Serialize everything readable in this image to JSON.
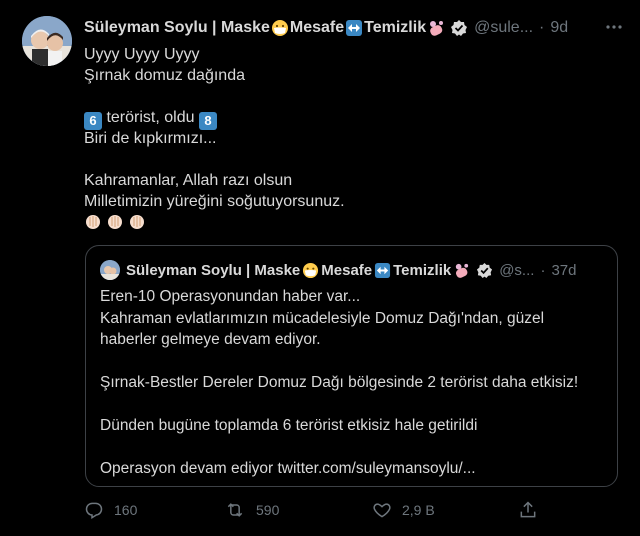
{
  "author": {
    "name": "Süleyman Soylu | Maske",
    "name_part2": "Mesafe",
    "name_part3": "Temizlik",
    "handle": "@sule...",
    "separator": "·",
    "time": "9d"
  },
  "tweet": {
    "lines": [
      "Uyyy Uyyy Uyyy",
      "Şırnak domuz dağında",
      "",
      "terörist, oldu",
      "Biri de kıpkırmızı...",
      "",
      "Kahramanlar, Allah razı olsun",
      "Milletimizin yüreğini soğutuyorsunuz."
    ],
    "keycap_left": "6",
    "keycap_right": "8"
  },
  "quoted": {
    "name": "Süleyman Soylu | Maske",
    "name_part2": "Mesafe",
    "name_part3": "Temizlik",
    "handle": "@s...",
    "separator": "·",
    "time": "37d",
    "lines": [
      "Eren-10 Operasyonundan haber var...",
      "Kahraman evlatlarımızın mücadelesiyle Domuz Dağı'ndan, güzel",
      "haberler gelmeye devam ediyor.",
      "",
      "Şırnak-Bestler Dereler Domuz Dağı bölgesinde 2 terörist daha etkisiz!",
      "",
      "Dünden bugüne toplamda 6 terörist etkisiz hale getirildi",
      "",
      "Operasyon devam ediyor twitter.com/suleymansoylu/..."
    ]
  },
  "actions": {
    "reply_count": "160",
    "retweet_count": "590",
    "like_count": "2,9 B"
  },
  "icons": {
    "more": "more-icon",
    "verified": "verified-badge-icon",
    "mask": "face-with-mask-icon",
    "arrows": "left-right-arrow-icon",
    "soap": "soap-icon",
    "clap": "clapping-hands-icon",
    "reply": "reply-icon",
    "retweet": "retweet-icon",
    "like": "heart-icon",
    "share": "share-icon"
  },
  "colors": {
    "background": "#000000",
    "text": "#d9d9d9",
    "muted": "#6e767d",
    "verified": "#d9d9d9",
    "keycap": "#3b88c3"
  }
}
